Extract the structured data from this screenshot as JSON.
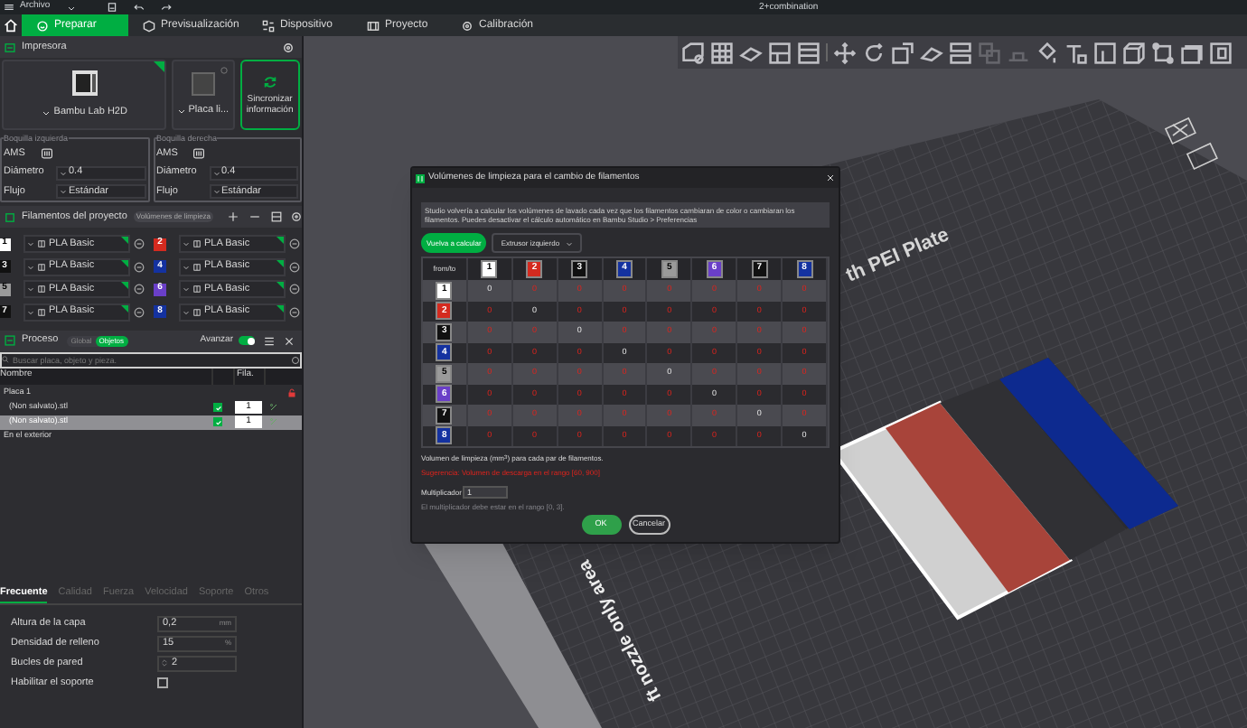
{
  "window": {
    "menu": "Archivo",
    "title": "2+combination"
  },
  "tabs": [
    {
      "label": "Preparar",
      "selected": true
    },
    {
      "label": "Previsualización",
      "selected": false
    },
    {
      "label": "Dispositivo",
      "selected": false
    },
    {
      "label": "Proyecto",
      "selected": false
    },
    {
      "label": "Calibración",
      "selected": false
    }
  ],
  "printer": {
    "title": "Impresora",
    "model": "Bambu Lab H2D",
    "plate": "Placa li...",
    "sync_button": "Sincronizar información",
    "nozzles": [
      {
        "legend": "Boquilla izquierda",
        "ams": "AMS",
        "diameter_label": "Diámetro",
        "diameter": "0.4",
        "flow_label": "Flujo",
        "flow": "Estándar"
      },
      {
        "legend": "Boquilla derecha",
        "ams": "AMS",
        "diameter_label": "Diámetro",
        "diameter": "0.4",
        "flow_label": "Flujo",
        "flow": "Estándar"
      }
    ]
  },
  "filaments": {
    "title": "Filamentos del proyecto",
    "badge": "Volúmenes de limpieza",
    "items": [
      {
        "number": "1",
        "color": "#ffffff",
        "name": "PLA Basic"
      },
      {
        "number": "2",
        "color": "#d42a1f",
        "name": "PLA Basic"
      },
      {
        "number": "3",
        "color": "#111111",
        "name": "PLA Basic"
      },
      {
        "number": "4",
        "color": "#1432a0",
        "name": "PLA Basic"
      },
      {
        "number": "5",
        "color": "#9a9a9a",
        "name": "PLA Basic"
      },
      {
        "number": "6",
        "color": "#6a3fc8",
        "name": "PLA Basic"
      },
      {
        "number": "7",
        "color": "#111111",
        "name": "PLA Basic"
      },
      {
        "number": "8",
        "color": "#1432a0",
        "name": "PLA Basic"
      }
    ]
  },
  "process": {
    "title": "Proceso",
    "scope": [
      {
        "label": "Global",
        "selected": false
      },
      {
        "label": "Objetos",
        "selected": true
      }
    ],
    "advanced_label": "Avanzar",
    "advanced_on": true,
    "search_placeholder": "Buscar placa, objeto y pieza.",
    "columns": [
      "Nombre",
      "Fila."
    ],
    "rows": [
      {
        "kind": "plate",
        "name": "Placa 1",
        "selected": false
      },
      {
        "kind": "object",
        "name": "(Non salvato).stl",
        "checked": true,
        "count": "1",
        "selected": false
      },
      {
        "kind": "object",
        "name": "(Non salvato).stl",
        "checked": true,
        "count": "1",
        "selected": true
      },
      {
        "kind": "group",
        "name": "En el exterior",
        "selected": false
      }
    ]
  },
  "settings": {
    "tabs": [
      {
        "label": "Frecuente",
        "selected": true
      },
      {
        "label": "Calidad",
        "selected": false
      },
      {
        "label": "Fuerza",
        "selected": false
      },
      {
        "label": "Velocidad",
        "selected": false
      },
      {
        "label": "Soporte",
        "selected": false
      },
      {
        "label": "Otros",
        "selected": false
      }
    ],
    "rows": [
      {
        "kind": "number",
        "label": "Altura de la capa",
        "value": "0,2",
        "unit": "mm"
      },
      {
        "kind": "number",
        "label": "Densidad de relleno",
        "value": "15",
        "unit": "%"
      },
      {
        "kind": "spin",
        "label": "Bucles de pared",
        "value": "2"
      },
      {
        "kind": "check",
        "label": "Habilitar el soporte",
        "checked": false
      }
    ]
  },
  "scene": {
    "plate_label": "th PEI Plate",
    "zone_label": "ft nozzle only area"
  },
  "dialog": {
    "title": "Volúmenes de limpieza para el cambio de filamentos",
    "info": "Studio volvería a calcular los volúmenes de lavado cada vez que los filamentos cambiaran de color o cambiaran los filamentos. Puedes desactivar el cálculo automático en Bambu Studio > Preferencias",
    "recalc_button": "Vuelva a calcular",
    "extruder": "Extrusor izquierdo",
    "corner": "from/to",
    "columns": [
      {
        "number": "1",
        "color": "#ffffff"
      },
      {
        "number": "2",
        "color": "#d42a1f"
      },
      {
        "number": "3",
        "color": "#111111"
      },
      {
        "number": "4",
        "color": "#1432a0"
      },
      {
        "number": "5",
        "color": "#9a9a9a"
      },
      {
        "number": "6",
        "color": "#6a3fc8"
      },
      {
        "number": "7",
        "color": "#111111"
      },
      {
        "number": "8",
        "color": "#1432a0"
      }
    ],
    "rows": [
      {
        "number": "1",
        "color": "#ffffff",
        "cells": [
          {
            "value": "0",
            "warning": false
          },
          {
            "value": "0",
            "warning": true
          },
          {
            "value": "0",
            "warning": true
          },
          {
            "value": "0",
            "warning": true
          },
          {
            "value": "0",
            "warning": true
          },
          {
            "value": "0",
            "warning": true
          },
          {
            "value": "0",
            "warning": true
          },
          {
            "value": "0",
            "warning": true
          }
        ]
      },
      {
        "number": "2",
        "color": "#d42a1f",
        "cells": [
          {
            "value": "0",
            "warning": true
          },
          {
            "value": "0",
            "warning": false
          },
          {
            "value": "0",
            "warning": true
          },
          {
            "value": "0",
            "warning": true
          },
          {
            "value": "0",
            "warning": true
          },
          {
            "value": "0",
            "warning": true
          },
          {
            "value": "0",
            "warning": true
          },
          {
            "value": "0",
            "warning": true
          }
        ]
      },
      {
        "number": "3",
        "color": "#111111",
        "cells": [
          {
            "value": "0",
            "warning": true
          },
          {
            "value": "0",
            "warning": true
          },
          {
            "value": "0",
            "warning": false
          },
          {
            "value": "0",
            "warning": true
          },
          {
            "value": "0",
            "warning": true
          },
          {
            "value": "0",
            "warning": true
          },
          {
            "value": "0",
            "warning": true
          },
          {
            "value": "0",
            "warning": true
          }
        ]
      },
      {
        "number": "4",
        "color": "#1432a0",
        "cells": [
          {
            "value": "0",
            "warning": true
          },
          {
            "value": "0",
            "warning": true
          },
          {
            "value": "0",
            "warning": true
          },
          {
            "value": "0",
            "warning": false
          },
          {
            "value": "0",
            "warning": true
          },
          {
            "value": "0",
            "warning": true
          },
          {
            "value": "0",
            "warning": true
          },
          {
            "value": "0",
            "warning": true
          }
        ]
      },
      {
        "number": "5",
        "color": "#9a9a9a",
        "cells": [
          {
            "value": "0",
            "warning": true
          },
          {
            "value": "0",
            "warning": true
          },
          {
            "value": "0",
            "warning": true
          },
          {
            "value": "0",
            "warning": true
          },
          {
            "value": "0",
            "warning": false
          },
          {
            "value": "0",
            "warning": true
          },
          {
            "value": "0",
            "warning": true
          },
          {
            "value": "0",
            "warning": true
          }
        ]
      },
      {
        "number": "6",
        "color": "#6a3fc8",
        "cells": [
          {
            "value": "0",
            "warning": true
          },
          {
            "value": "0",
            "warning": true
          },
          {
            "value": "0",
            "warning": true
          },
          {
            "value": "0",
            "warning": true
          },
          {
            "value": "0",
            "warning": true
          },
          {
            "value": "0",
            "warning": false
          },
          {
            "value": "0",
            "warning": true
          },
          {
            "value": "0",
            "warning": true
          }
        ]
      },
      {
        "number": "7",
        "color": "#111111",
        "cells": [
          {
            "value": "0",
            "warning": true
          },
          {
            "value": "0",
            "warning": true
          },
          {
            "value": "0",
            "warning": true
          },
          {
            "value": "0",
            "warning": true
          },
          {
            "value": "0",
            "warning": true
          },
          {
            "value": "0",
            "warning": true
          },
          {
            "value": "0",
            "warning": false
          },
          {
            "value": "0",
            "warning": true
          }
        ]
      },
      {
        "number": "8",
        "color": "#1432a0",
        "cells": [
          {
            "value": "0",
            "warning": true
          },
          {
            "value": "0",
            "warning": true
          },
          {
            "value": "0",
            "warning": true
          },
          {
            "value": "0",
            "warning": true
          },
          {
            "value": "0",
            "warning": true
          },
          {
            "value": "0",
            "warning": true
          },
          {
            "value": "0",
            "warning": true
          },
          {
            "value": "0",
            "warning": false
          }
        ]
      }
    ],
    "caption": "Volumen de limpieza (mm$^{3}$) para cada par de filamentos.",
    "suggestion": "Sugerencia: Volumen de descarga en el rango [60, 900]",
    "multiplier_label": "Multiplicador",
    "multiplier": "1",
    "multiplier_hint": "El multiplicador debe estar en el rango [0, 3].",
    "ok_button": "OK",
    "cancel_button": "Cancelar"
  }
}
